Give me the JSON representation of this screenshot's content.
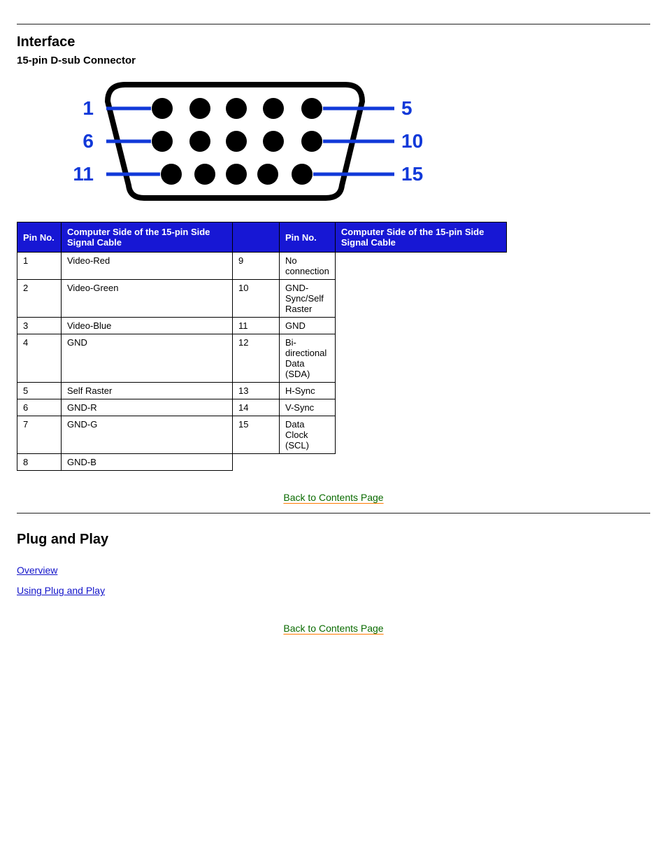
{
  "section1": {
    "heading": "Interface",
    "subheading": "15-pin D-sub Connector",
    "connector": {
      "left_labels": [
        "1",
        "6",
        "11"
      ],
      "right_labels": [
        "5",
        "10",
        "15"
      ]
    },
    "table": {
      "headers": {
        "pin_left": "Pin\nNo.",
        "sig_left": "Computer Side of the 15-pin\nSide Signal Cable",
        "pin_right": "Pin\nNo.",
        "sig_right": "Computer Side of the 15-pin\nSide Signal Cable"
      },
      "left": [
        {
          "pin": "1",
          "sig": "Video-Red"
        },
        {
          "pin": "2",
          "sig": "Video-Green"
        },
        {
          "pin": "3",
          "sig": "Video-Blue"
        },
        {
          "pin": "4",
          "sig": "GND"
        },
        {
          "pin": "5",
          "sig": "Self Raster"
        },
        {
          "pin": "6",
          "sig": "GND-R"
        },
        {
          "pin": "7",
          "sig": "GND-G"
        },
        {
          "pin": "8",
          "sig": "GND-B"
        }
      ],
      "right": [
        {
          "pin": "9",
          "sig": "No connection"
        },
        {
          "pin": "10",
          "sig": "GND-Sync/Self Raster"
        },
        {
          "pin": "11",
          "sig": "GND"
        },
        {
          "pin": "12",
          "sig": "Bi-directional Data (SDA)"
        },
        {
          "pin": "13",
          "sig": "H-Sync"
        },
        {
          "pin": "14",
          "sig": "V-Sync"
        },
        {
          "pin": "15",
          "sig": "Data Clock (SCL)"
        }
      ]
    }
  },
  "back": {
    "label": "Back to Contents Page"
  },
  "section2": {
    "heading": "Plug and Play",
    "links": {
      "overview": "Overview",
      "use": "Using Plug and Play"
    }
  }
}
